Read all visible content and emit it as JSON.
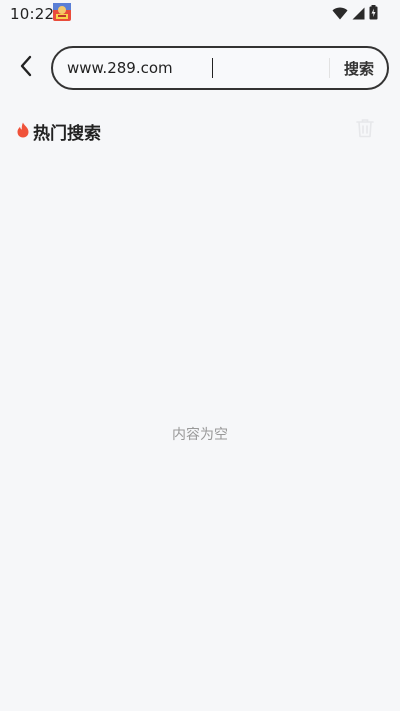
{
  "status_bar": {
    "time": "10:22"
  },
  "search": {
    "value": "www.289.com",
    "button_label": "搜索"
  },
  "hot_search": {
    "title": "热门搜索"
  },
  "empty": {
    "text": "内容为空"
  },
  "colors": {
    "background": "#f6f7f9",
    "fire": "#f0523a",
    "border": "#333333",
    "muted_text": "#999999"
  },
  "icons": {
    "back": "chevron-left-icon",
    "fire": "fire-icon",
    "trash": "trash-icon",
    "wifi": "wifi-icon",
    "signal": "signal-icon",
    "battery": "battery-icon"
  }
}
